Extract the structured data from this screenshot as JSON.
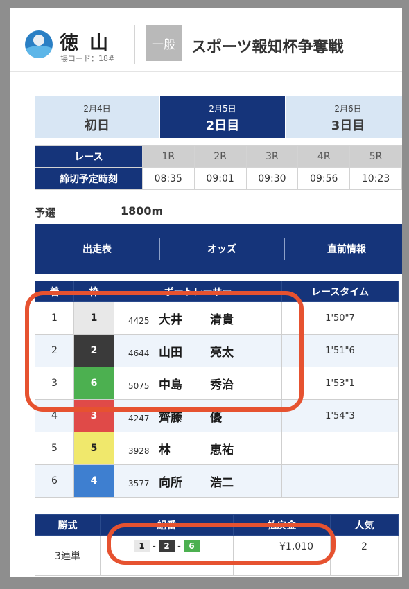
{
  "colors": {
    "navy": "#15347a",
    "highlight": "#e65230",
    "frame_1": "#e8e8e8",
    "frame_2": "#3a3a3a",
    "frame_3": "#e04a48",
    "frame_4": "#3e7fd0",
    "frame_5": "#f0e86c",
    "frame_6": "#4cb050"
  },
  "header": {
    "venue": "徳山",
    "venue_code": "場コード：18#",
    "grade": "一般",
    "race_title": "スポーツ報知杯争奪戦",
    "logo_icon": "tokuyama-logo-icon"
  },
  "day_tabs": [
    {
      "date": "2月4日",
      "label": "初日",
      "active": false
    },
    {
      "date": "2月5日",
      "label": "2日目",
      "active": true
    },
    {
      "date": "2月6日",
      "label": "3日目",
      "active": false
    }
  ],
  "schedule": {
    "race_header": "レース",
    "deadline_header": "締切予定時刻",
    "races": [
      {
        "race": "1R",
        "time": "08:35"
      },
      {
        "race": "2R",
        "time": "09:01"
      },
      {
        "race": "3R",
        "time": "09:30"
      },
      {
        "race": "4R",
        "time": "09:56"
      },
      {
        "race": "5R",
        "time": "10:23"
      }
    ]
  },
  "race_info": {
    "type": "予選",
    "distance": "1800m"
  },
  "nav": {
    "entry_list": "出走表",
    "odds": "オッズ",
    "pre_race": "直前情報"
  },
  "results": {
    "headers": {
      "rank": "着",
      "frame": "枠",
      "racer": "ボートレーサー",
      "time": "レースタイム"
    },
    "rows": [
      {
        "rank": "1",
        "frame": "1",
        "reg": "4425",
        "surname": "大井",
        "given": "清貴",
        "time": "1'50\"7"
      },
      {
        "rank": "2",
        "frame": "2",
        "reg": "4644",
        "surname": "山田",
        "given": "亮太",
        "time": "1'51\"6"
      },
      {
        "rank": "3",
        "frame": "6",
        "reg": "5075",
        "surname": "中島",
        "given": "秀治",
        "time": "1'53\"1"
      },
      {
        "rank": "4",
        "frame": "3",
        "reg": "4247",
        "surname": "齊藤",
        "given": "優",
        "time": "1'54\"3"
      },
      {
        "rank": "5",
        "frame": "5",
        "reg": "3928",
        "surname": "林",
        "given": "恵祐",
        "time": ""
      },
      {
        "rank": "6",
        "frame": "4",
        "reg": "3577",
        "surname": "向所",
        "given": "浩二",
        "time": ""
      }
    ]
  },
  "payout": {
    "headers": {
      "bet_type": "勝式",
      "combination": "組番",
      "amount": "払戻金",
      "popularity": "人気"
    },
    "rows": [
      {
        "bet_type": "3連単",
        "combo": [
          "1",
          "2",
          "6"
        ],
        "amount": "¥1,010",
        "popularity": "2"
      }
    ]
  }
}
